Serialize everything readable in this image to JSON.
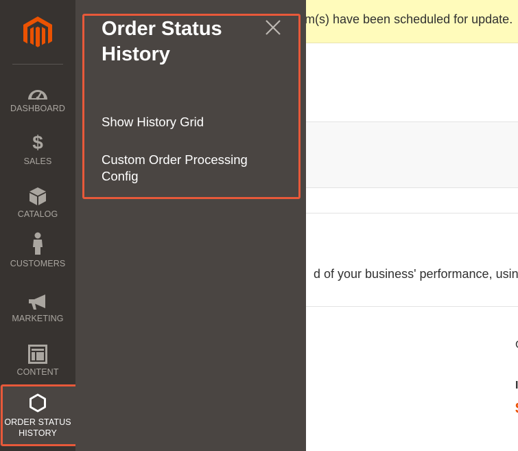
{
  "nav": {
    "logo": "magento-logo",
    "items": [
      {
        "label": "DASHBOARD",
        "icon": "dashboard-gauge-icon"
      },
      {
        "label": "SALES",
        "icon": "dollar-icon"
      },
      {
        "label": "CATALOG",
        "icon": "box-icon"
      },
      {
        "label": "CUSTOMERS",
        "icon": "person-icon"
      },
      {
        "label": "MARKETING",
        "icon": "megaphone-icon"
      },
      {
        "label": "CONTENT",
        "icon": "layout-icon"
      },
      {
        "label": "ORDER STATUS HISTORY",
        "label_line1": "ORDER STATUS",
        "label_line2": "HISTORY",
        "icon": "hexagon-icon",
        "active": true
      }
    ]
  },
  "flyout": {
    "title_line1": "Order Status",
    "title_line2": "History",
    "links": [
      {
        "label": "Show History Grid"
      },
      {
        "label_line1": "Custom Order Processing",
        "label_line2": "Config"
      }
    ],
    "close_icon": "close-icon"
  },
  "page": {
    "notice_text": "em(s) have been scheduled for update.",
    "intro_text": "d of your business' performance, using",
    "edge_char_1": "C",
    "edge_char_2": "I",
    "edge_char_3": "$"
  },
  "colors": {
    "nav_bg": "#373330",
    "flyout_bg": "#4a4542",
    "highlight": "#e8593a",
    "logo": "#eb5202",
    "notice_bg": "#fffbbb"
  }
}
